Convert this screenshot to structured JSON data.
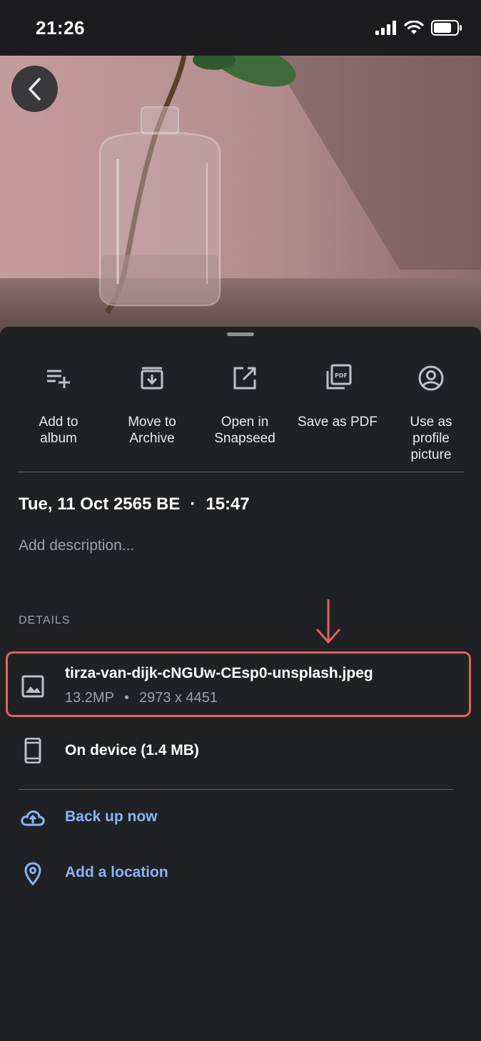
{
  "status_bar": {
    "time": "21:26",
    "icons": [
      "cellular-signal-icon",
      "wifi-icon",
      "battery-icon"
    ]
  },
  "photo": {
    "description_icon": "photo-preview"
  },
  "actions": [
    {
      "label": "Add to\nalbum",
      "icon": "playlist-add-icon"
    },
    {
      "label": "Move to\nArchive",
      "icon": "archive-icon"
    },
    {
      "label": "Open in\nSnapseed",
      "icon": "open-external-icon"
    },
    {
      "label": "Save as PDF",
      "icon": "pdf-icon"
    },
    {
      "label": "Use as\nprofile\npicture",
      "icon": "account-circle-icon"
    }
  ],
  "info": {
    "date": "Tue, 11 Oct 2565 BE",
    "separator": "·",
    "time": "15:47",
    "description_placeholder": "Add description..."
  },
  "details": {
    "heading": "DETAILS",
    "file": {
      "name": "tirza-van-dijk-cNGUw-CEsp0-unsplash.jpeg",
      "megapixels": "13.2MP",
      "separator": "•",
      "dimensions": "2973 x 4451"
    },
    "storage": "On device (1.4 MB)"
  },
  "links": {
    "backup": "Back up now",
    "location": "Add a location"
  },
  "colors": {
    "background": "#202124",
    "link": "#8ab4f8",
    "highlight": "#e06164",
    "secondary_text": "#9aa0a6"
  }
}
